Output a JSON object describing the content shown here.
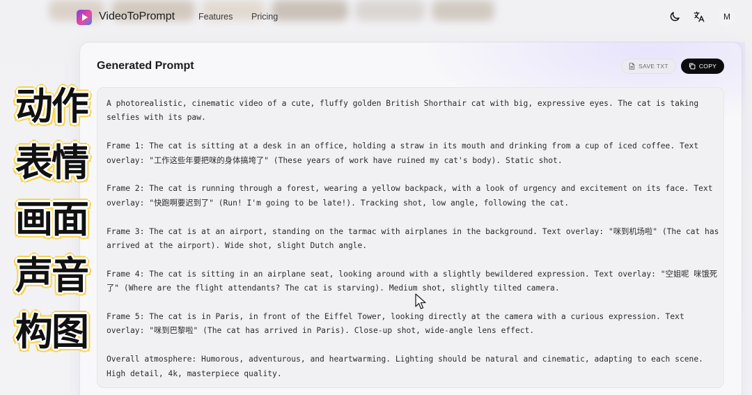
{
  "nav": {
    "brand": "VideoToPrompt",
    "links": [
      "Features",
      "Pricing"
    ],
    "avatar_initial": "M",
    "icons": [
      "moon-icon",
      "translate-icon"
    ]
  },
  "card": {
    "title": "Generated Prompt",
    "save_label": "SAVE TXT",
    "copy_label": "COPY",
    "paragraphs": [
      "A photorealistic, cinematic video of a cute, fluffy golden British Shorthair cat with big, expressive eyes. The cat is taking selfies with its paw.",
      "Frame 1: The cat is sitting at a desk in an office, holding a straw in its mouth and drinking from a cup of iced coffee. Text overlay: \"工作这些年要把咪的身体搞垮了\" (These years of work have ruined my cat's body). Static shot.",
      "Frame 2: The cat is running through a forest, wearing a yellow backpack, with a look of urgency and excitement on its face. Text overlay: \"快跑啊要迟到了\" (Run! I'm going to be late!). Tracking shot, low angle, following the cat.",
      "Frame 3: The cat is at an airport, standing on the tarmac with airplanes in the background. Text overlay: \"咪到机场啦\" (The cat has arrived at the airport). Wide shot, slight Dutch angle.",
      "Frame 4: The cat is sitting in an airplane seat, looking around with a slightly bewildered expression. Text overlay: \"空姐呢 咪饿死了\" (Where are the flight attendants? The cat is starving). Medium shot, slightly tilted camera.",
      "Frame 5: The cat is in Paris, in front of the Eiffel Tower, looking directly at the camera with a curious expression. Text overlay: \"咪到巴黎啦\" (The cat has arrived in Paris). Close-up shot, wide-angle lens effect.",
      "Overall atmosphere: Humorous, adventurous, and heartwarming. Lighting should be natural and cinematic, adapting to each scene. High detail, 4k, masterpiece quality."
    ]
  },
  "caption": {
    "items": [
      "动作",
      "表情",
      "画面",
      "声音",
      "构图"
    ],
    "text_color": "#111111",
    "outline_color": "#f5d24a"
  }
}
